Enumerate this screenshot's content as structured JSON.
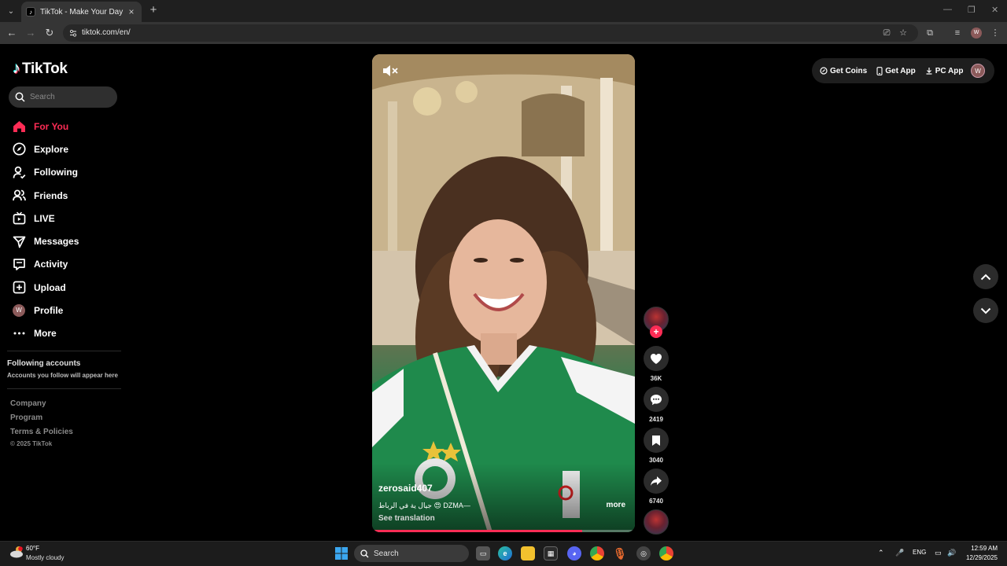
{
  "browser": {
    "tab_title": "TikTok - Make Your Day",
    "url": "tiktok.com/en/",
    "profile_initial": "W"
  },
  "sidebar": {
    "logo_text": "TikTok",
    "search_placeholder": "Search",
    "nav": [
      {
        "label": "For You",
        "icon": "home-icon",
        "active": true
      },
      {
        "label": "Explore",
        "icon": "compass-icon"
      },
      {
        "label": "Following",
        "icon": "user-follow-icon"
      },
      {
        "label": "Friends",
        "icon": "friends-icon"
      },
      {
        "label": "LIVE",
        "icon": "live-icon"
      },
      {
        "label": "Messages",
        "icon": "send-icon"
      },
      {
        "label": "Activity",
        "icon": "activity-icon"
      },
      {
        "label": "Upload",
        "icon": "upload-icon"
      },
      {
        "label": "Profile",
        "icon": "avatar"
      },
      {
        "label": "More",
        "icon": "more-icon"
      }
    ],
    "profile_initial": "W",
    "following_title": "Following accounts",
    "following_sub": "Accounts you follow will appear here",
    "footer": {
      "company": "Company",
      "program": "Program",
      "terms": "Terms & Policies",
      "copyright": "© 2025 TikTok"
    }
  },
  "video": {
    "username": "zerosaid407",
    "caption": "جيال ية في الرباط 😍 DZMA—",
    "see_translation": "See translation",
    "more": "more",
    "progress": 0.8
  },
  "actions": {
    "likes": "36K",
    "comments": "2419",
    "saves": "3040",
    "shares": "6740"
  },
  "top_right": {
    "get_coins": "Get Coins",
    "get_app": "Get App",
    "pc_app": "PC App",
    "profile_initial": "W"
  },
  "taskbar": {
    "temp": "60°F",
    "weather": "Mostly cloudy",
    "search": "Search",
    "lang": "ENG",
    "time": "12:59 AM",
    "date": "12/29/2025"
  }
}
